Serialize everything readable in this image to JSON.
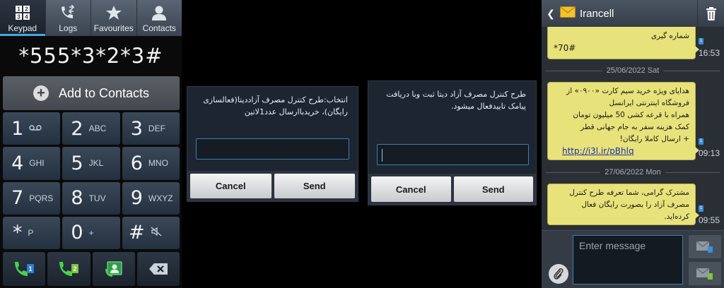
{
  "dialer": {
    "tabs": [
      {
        "label": "Keypad",
        "icon": "keypad-icon",
        "active": true
      },
      {
        "label": "Logs",
        "icon": "call-logs-icon"
      },
      {
        "label": "Favourites",
        "icon": "star-icon"
      },
      {
        "label": "Contacts",
        "icon": "person-icon"
      }
    ],
    "number": "*555*3*2*3#",
    "add_to_contacts": "Add to Contacts",
    "keys": [
      {
        "digit": "1",
        "letters": ""
      },
      {
        "digit": "2",
        "letters": "ABC"
      },
      {
        "digit": "3",
        "letters": "DEF"
      },
      {
        "digit": "4",
        "letters": "GHI"
      },
      {
        "digit": "5",
        "letters": "JKL"
      },
      {
        "digit": "6",
        "letters": "MNO"
      },
      {
        "digit": "7",
        "letters": "PQRS"
      },
      {
        "digit": "8",
        "letters": "TUV"
      },
      {
        "digit": "9",
        "letters": "WXYZ"
      },
      {
        "digit": "*",
        "letters": "P"
      },
      {
        "digit": "0",
        "letters": "+"
      },
      {
        "digit": "#",
        "letters": ""
      }
    ],
    "sim1_badge": "1",
    "sim2_badge": "2"
  },
  "dialog1": {
    "message": "انتخاب:طرح کنترل مصرف آزاددیتا(فعالسازی رایگان)، خریدباارسال عدد1لاتین",
    "cancel": "Cancel",
    "send": "Send"
  },
  "dialog2": {
    "message": "طرح کنترل مصرف آزاد دیتا ثبت وبا دریافت پیامک تاییدفعال میشود.",
    "cancel": "Cancel",
    "send": "Send"
  },
  "sms": {
    "contact": "Irancell",
    "messages": [
      {
        "text_rtl": "شماره گیری",
        "text_ltr": "*70#",
        "time": "16:53"
      },
      {
        "date": "25/06/2022 Sat"
      },
      {
        "lines": [
          "هدایای ویژه خرید سیم کارت «۰۹۰۰» از",
          "فروشگاه اینترنتی ایرانسل",
          "همراه با قرعه کشی 50 میلیون تومان",
          "کمک هزینه سفر به جام جهانی قطر",
          "+ ارسال کاملا رایگان!"
        ],
        "link": "http://i3l.ir/pBhlq",
        "time": "09:13"
      },
      {
        "date": "27/06/2022 Mon"
      },
      {
        "lines": [
          "مشترک گرامی، شما تعرفه  طرح کنترل",
          "مصرف آزاد  را بصورت رایگان فعال",
          "کرده‌اید."
        ],
        "time": "09:55"
      }
    ],
    "input_placeholder": "Enter message",
    "sim_badge": "1"
  }
}
